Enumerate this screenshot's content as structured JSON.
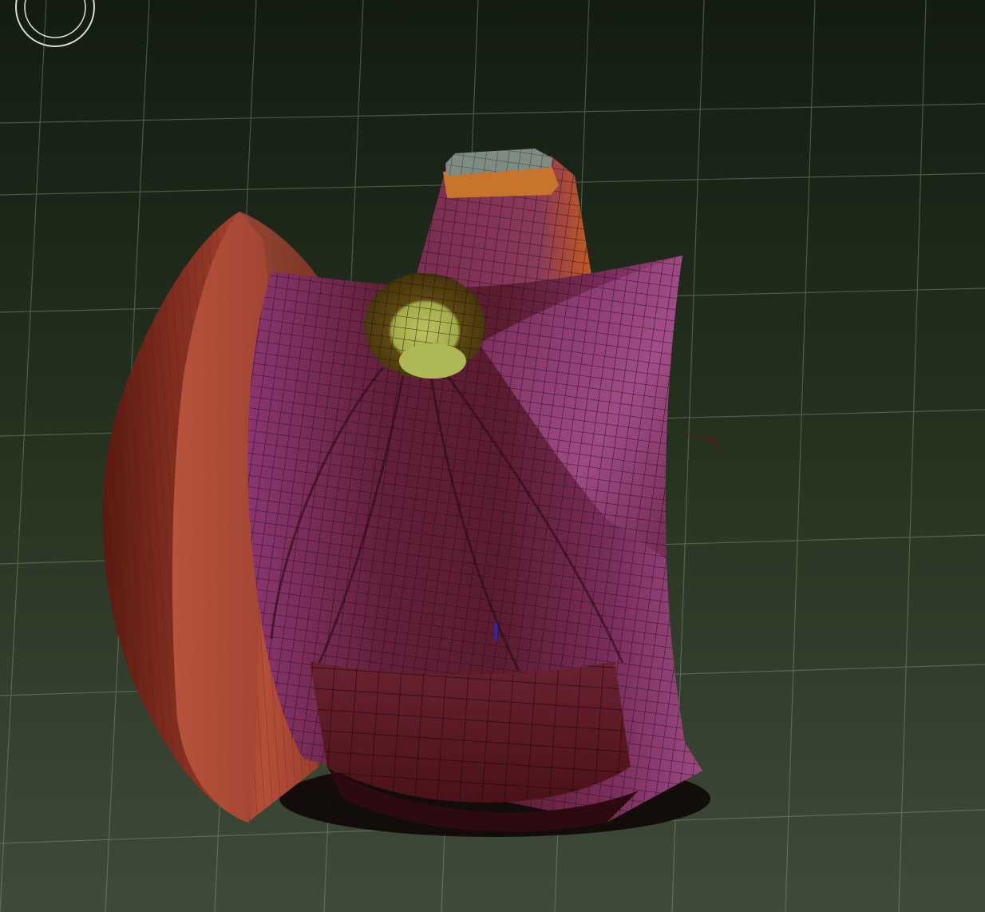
{
  "app": {
    "type": "3d-viewport",
    "background_top": "#141c12",
    "background_bottom": "#3d4a38"
  },
  "viewport": {
    "grid": true,
    "grid_color": "#8a9880",
    "navigation_widget_icon": "orbit-ring-icon",
    "model": {
      "description_icon": "3d-mesh-model",
      "wireframe": true,
      "colors": {
        "left_flange": "#7a2a1c",
        "left_flange_highlight": "#c0533a",
        "center_funnel": "#6b2236",
        "center_funnel_highlight": "#b05a8a",
        "right_fin": "#7b3061",
        "top_neck": "#c86a24",
        "top_cap": "#7d8a82",
        "hole_inner": "#5e4a12",
        "hole_bottom": "#a8b450",
        "front_plate": "#5a1a24",
        "shadow": "#120808"
      }
    }
  }
}
